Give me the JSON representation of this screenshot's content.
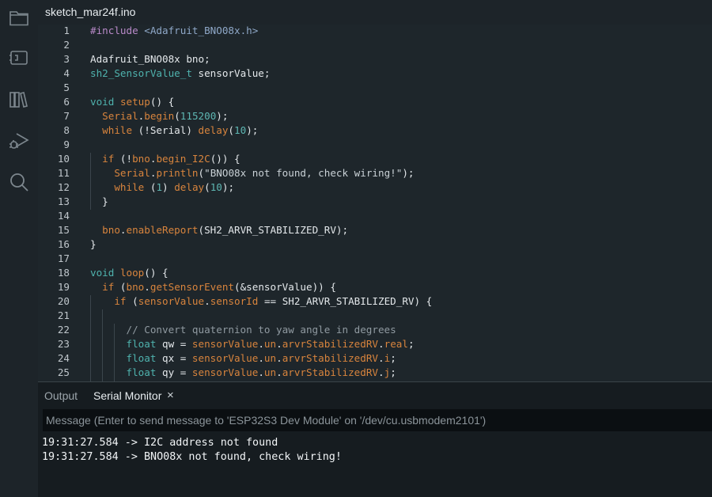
{
  "tab": {
    "file_name": "sketch_mar24f.ino"
  },
  "activity_icons": [
    "folder-icon",
    "board-icon",
    "library-icon",
    "debug-icon",
    "search-icon"
  ],
  "code_lines": [
    {
      "n": "1",
      "indent": 0,
      "tokens": [
        [
          "prep",
          "#include "
        ],
        [
          "inc",
          "<Adafruit_BNO08x.h>"
        ]
      ]
    },
    {
      "n": "2",
      "indent": 0,
      "tokens": []
    },
    {
      "n": "3",
      "indent": 0,
      "tokens": [
        [
          "plain",
          "Adafruit_BNO08x bno;"
        ]
      ]
    },
    {
      "n": "4",
      "indent": 0,
      "tokens": [
        [
          "teal",
          "sh2_SensorValue_t"
        ],
        [
          "plain",
          " sensorValue;"
        ]
      ]
    },
    {
      "n": "5",
      "indent": 0,
      "tokens": []
    },
    {
      "n": "6",
      "indent": 0,
      "tokens": [
        [
          "teal",
          "void"
        ],
        [
          "plain",
          " "
        ],
        [
          "kw",
          "setup"
        ],
        [
          "plain",
          "() {"
        ]
      ]
    },
    {
      "n": "7",
      "indent": 2,
      "tokens": [
        [
          "kw",
          "Serial"
        ],
        [
          "plain",
          "."
        ],
        [
          "kw",
          "begin"
        ],
        [
          "plain",
          "("
        ],
        [
          "num",
          "115200"
        ],
        [
          "plain",
          ");"
        ]
      ]
    },
    {
      "n": "8",
      "indent": 2,
      "tokens": [
        [
          "kw",
          "while"
        ],
        [
          "plain",
          " (!Serial) "
        ],
        [
          "kw",
          "delay"
        ],
        [
          "plain",
          "("
        ],
        [
          "num",
          "10"
        ],
        [
          "plain",
          ");"
        ]
      ]
    },
    {
      "n": "9",
      "indent": 0,
      "tokens": []
    },
    {
      "n": "10",
      "indent": 2,
      "tokens": [
        [
          "kw",
          "if"
        ],
        [
          "plain",
          " (!"
        ],
        [
          "kw",
          "bno"
        ],
        [
          "plain",
          "."
        ],
        [
          "kw",
          "begin_I2C"
        ],
        [
          "plain",
          "()) {"
        ]
      ]
    },
    {
      "n": "11",
      "indent": 4,
      "tokens": [
        [
          "kw",
          "Serial"
        ],
        [
          "plain",
          "."
        ],
        [
          "kw",
          "println"
        ],
        [
          "plain",
          "("
        ],
        [
          "str",
          "\"BNO08x not found, check wiring!\""
        ],
        [
          "plain",
          ");"
        ]
      ]
    },
    {
      "n": "12",
      "indent": 4,
      "tokens": [
        [
          "kw",
          "while"
        ],
        [
          "plain",
          " ("
        ],
        [
          "num",
          "1"
        ],
        [
          "plain",
          ") "
        ],
        [
          "kw",
          "delay"
        ],
        [
          "plain",
          "("
        ],
        [
          "num",
          "10"
        ],
        [
          "plain",
          ");"
        ]
      ]
    },
    {
      "n": "13",
      "indent": 2,
      "tokens": [
        [
          "plain",
          "}"
        ]
      ]
    },
    {
      "n": "14",
      "indent": 0,
      "tokens": []
    },
    {
      "n": "15",
      "indent": 2,
      "tokens": [
        [
          "kw",
          "bno"
        ],
        [
          "plain",
          "."
        ],
        [
          "kw",
          "enableReport"
        ],
        [
          "plain",
          "(SH2_ARVR_STABILIZED_RV);"
        ]
      ]
    },
    {
      "n": "16",
      "indent": 0,
      "tokens": [
        [
          "plain",
          "}"
        ]
      ]
    },
    {
      "n": "17",
      "indent": 0,
      "tokens": []
    },
    {
      "n": "18",
      "indent": 0,
      "tokens": [
        [
          "teal",
          "void"
        ],
        [
          "plain",
          " "
        ],
        [
          "kw",
          "loop"
        ],
        [
          "plain",
          "() {"
        ]
      ]
    },
    {
      "n": "19",
      "indent": 2,
      "tokens": [
        [
          "kw",
          "if"
        ],
        [
          "plain",
          " ("
        ],
        [
          "kw",
          "bno"
        ],
        [
          "plain",
          "."
        ],
        [
          "kw",
          "getSensorEvent"
        ],
        [
          "plain",
          "(&sensorValue)) {"
        ]
      ]
    },
    {
      "n": "20",
      "indent": 4,
      "tokens": [
        [
          "kw",
          "if"
        ],
        [
          "plain",
          " ("
        ],
        [
          "kw",
          "sensorValue"
        ],
        [
          "plain",
          "."
        ],
        [
          "kw",
          "sensorId"
        ],
        [
          "plain",
          " == SH2_ARVR_STABILIZED_RV) {"
        ]
      ]
    },
    {
      "n": "21",
      "indent": 0,
      "tokens": []
    },
    {
      "n": "22",
      "indent": 6,
      "tokens": [
        [
          "com",
          "// Convert quaternion to yaw angle in degrees"
        ]
      ]
    },
    {
      "n": "23",
      "indent": 6,
      "tokens": [
        [
          "teal",
          "float"
        ],
        [
          "plain",
          " qw = "
        ],
        [
          "kw",
          "sensorValue"
        ],
        [
          "plain",
          "."
        ],
        [
          "kw",
          "un"
        ],
        [
          "plain",
          "."
        ],
        [
          "kw",
          "arvrStabilizedRV"
        ],
        [
          "plain",
          "."
        ],
        [
          "kw",
          "real"
        ],
        [
          "plain",
          ";"
        ]
      ]
    },
    {
      "n": "24",
      "indent": 6,
      "tokens": [
        [
          "teal",
          "float"
        ],
        [
          "plain",
          " qx = "
        ],
        [
          "kw",
          "sensorValue"
        ],
        [
          "plain",
          "."
        ],
        [
          "kw",
          "un"
        ],
        [
          "plain",
          "."
        ],
        [
          "kw",
          "arvrStabilizedRV"
        ],
        [
          "plain",
          "."
        ],
        [
          "kw",
          "i"
        ],
        [
          "plain",
          ";"
        ]
      ]
    },
    {
      "n": "25",
      "indent": 6,
      "tokens": [
        [
          "teal",
          "float"
        ],
        [
          "plain",
          " qy = "
        ],
        [
          "kw",
          "sensorValue"
        ],
        [
          "plain",
          "."
        ],
        [
          "kw",
          "un"
        ],
        [
          "plain",
          "."
        ],
        [
          "kw",
          "arvrStabilizedRV"
        ],
        [
          "plain",
          "."
        ],
        [
          "kw",
          "j"
        ],
        [
          "plain",
          ";"
        ]
      ]
    }
  ],
  "panel": {
    "tabs": [
      {
        "label": "Output",
        "active": false
      },
      {
        "label": "Serial Monitor",
        "active": true
      }
    ],
    "close_glyph": "×",
    "message_placeholder": "Message (Enter to send message to 'ESP32S3 Dev Module' on '/dev/cu.usbmodem2101')",
    "output_lines": [
      "19:31:27.584 -> I2C address not found",
      "19:31:27.584 -> BNO08x not found, check wiring!"
    ]
  },
  "colors": {
    "background": "#1d2429",
    "editor_bg": "#1e262b",
    "keyword_orange": "#d8843d",
    "type_teal": "#4fb3ae",
    "preprocessor_purple": "#b98ac9"
  }
}
